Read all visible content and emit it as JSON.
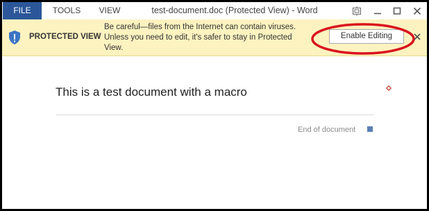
{
  "window": {
    "title": "test-document.doc (Protected View) - Word"
  },
  "menu": {
    "tabs": [
      "FILE",
      "TOOLS",
      "VIEW"
    ]
  },
  "window_controls": {
    "icons": [
      "ribbon-display-icon",
      "minimize-icon",
      "maximize-icon",
      "close-icon"
    ]
  },
  "banner": {
    "title": "PROTECTED VIEW",
    "message_lines": [
      "Be careful—files from the Internet can contain viruses.",
      "Unless you need to edit, it's safer to stay in Protected",
      "View."
    ],
    "button_label": "Enable Editing",
    "icon": "shield-icon",
    "close_icon": "close-icon",
    "background_color": "#fdf3c0",
    "highlight_color": "#d9141e"
  },
  "document": {
    "heading": "This is a test document with a macro",
    "end_label": "End of document"
  },
  "colors": {
    "file_tab": "#2b579a",
    "end_marker": "#5b7fb4"
  }
}
